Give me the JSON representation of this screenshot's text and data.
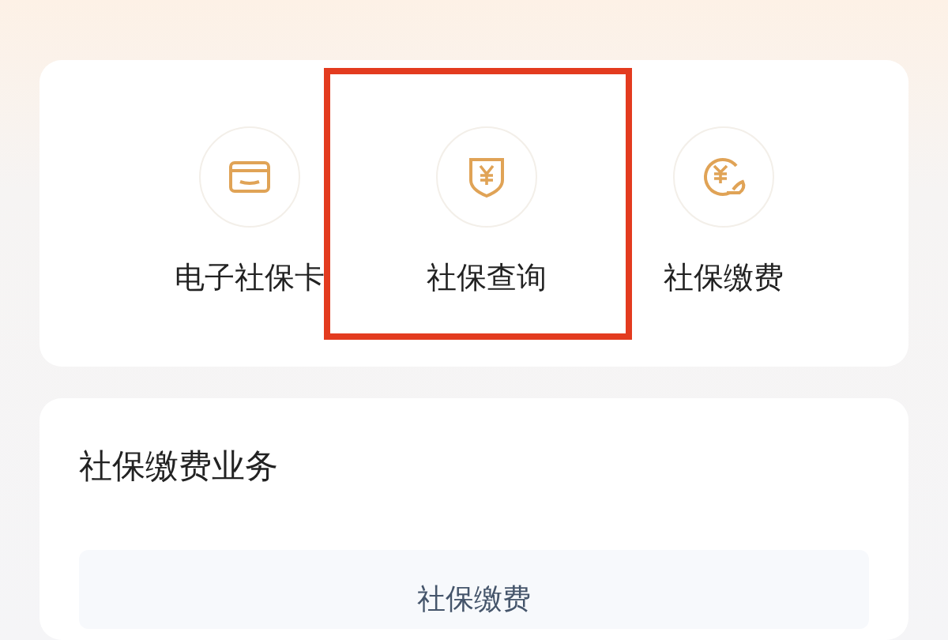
{
  "services": [
    {
      "kind": "card",
      "label": "电子社保卡",
      "highlighted": false
    },
    {
      "kind": "shield",
      "label": "社保查询",
      "highlighted": true
    },
    {
      "kind": "coin",
      "label": "社保缴费",
      "highlighted": false
    }
  ],
  "business": {
    "title": "社保缴费业务",
    "items": [
      {
        "label": "社保缴费"
      }
    ]
  }
}
